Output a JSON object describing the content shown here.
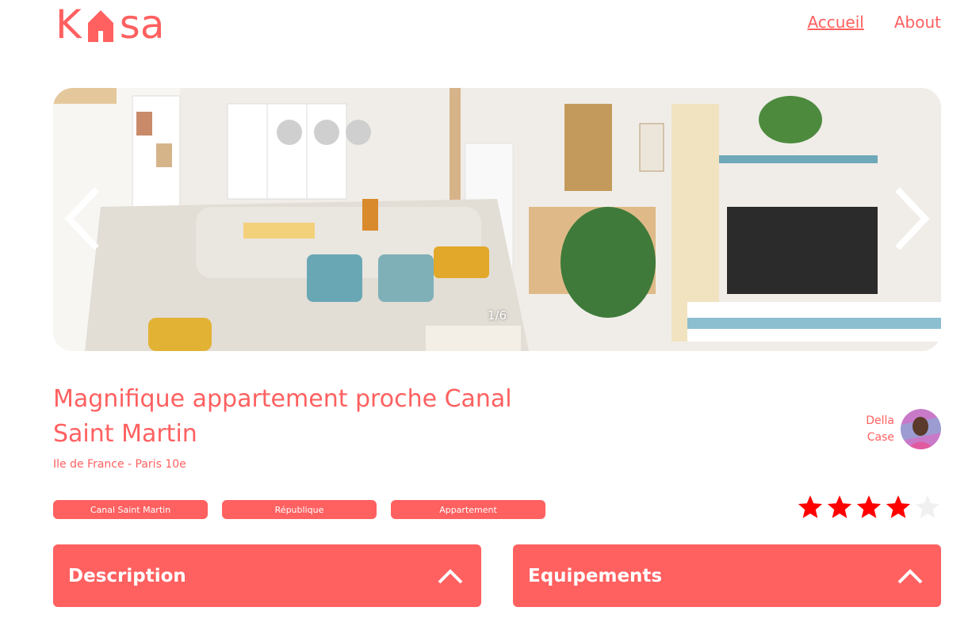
{
  "header": {
    "logo": "Kasa",
    "nav": [
      {
        "label": "Accueil",
        "active": true
      },
      {
        "label": "About",
        "active": false
      }
    ]
  },
  "gallery": {
    "counter": "1/6",
    "prev_icon": "chevron-left-icon",
    "next_icon": "chevron-right-icon"
  },
  "listing": {
    "title": "Magnifique appartement proche Canal Saint Martin",
    "location": "Ile de France - Paris 10e",
    "tags": [
      "Canal Saint Martin",
      "République",
      "Appartement"
    ],
    "rating": 4,
    "rating_max": 5
  },
  "host": {
    "first_name": "Della",
    "last_name": "Case"
  },
  "sections": {
    "description": {
      "title": "Description",
      "icon": "chevron-up-icon"
    },
    "equipments": {
      "title": "Equipements",
      "icon": "chevron-up-icon"
    }
  },
  "colors": {
    "accent": "#ff6060",
    "star_on": "#ff0000",
    "star_off": "#f0f0f0"
  }
}
